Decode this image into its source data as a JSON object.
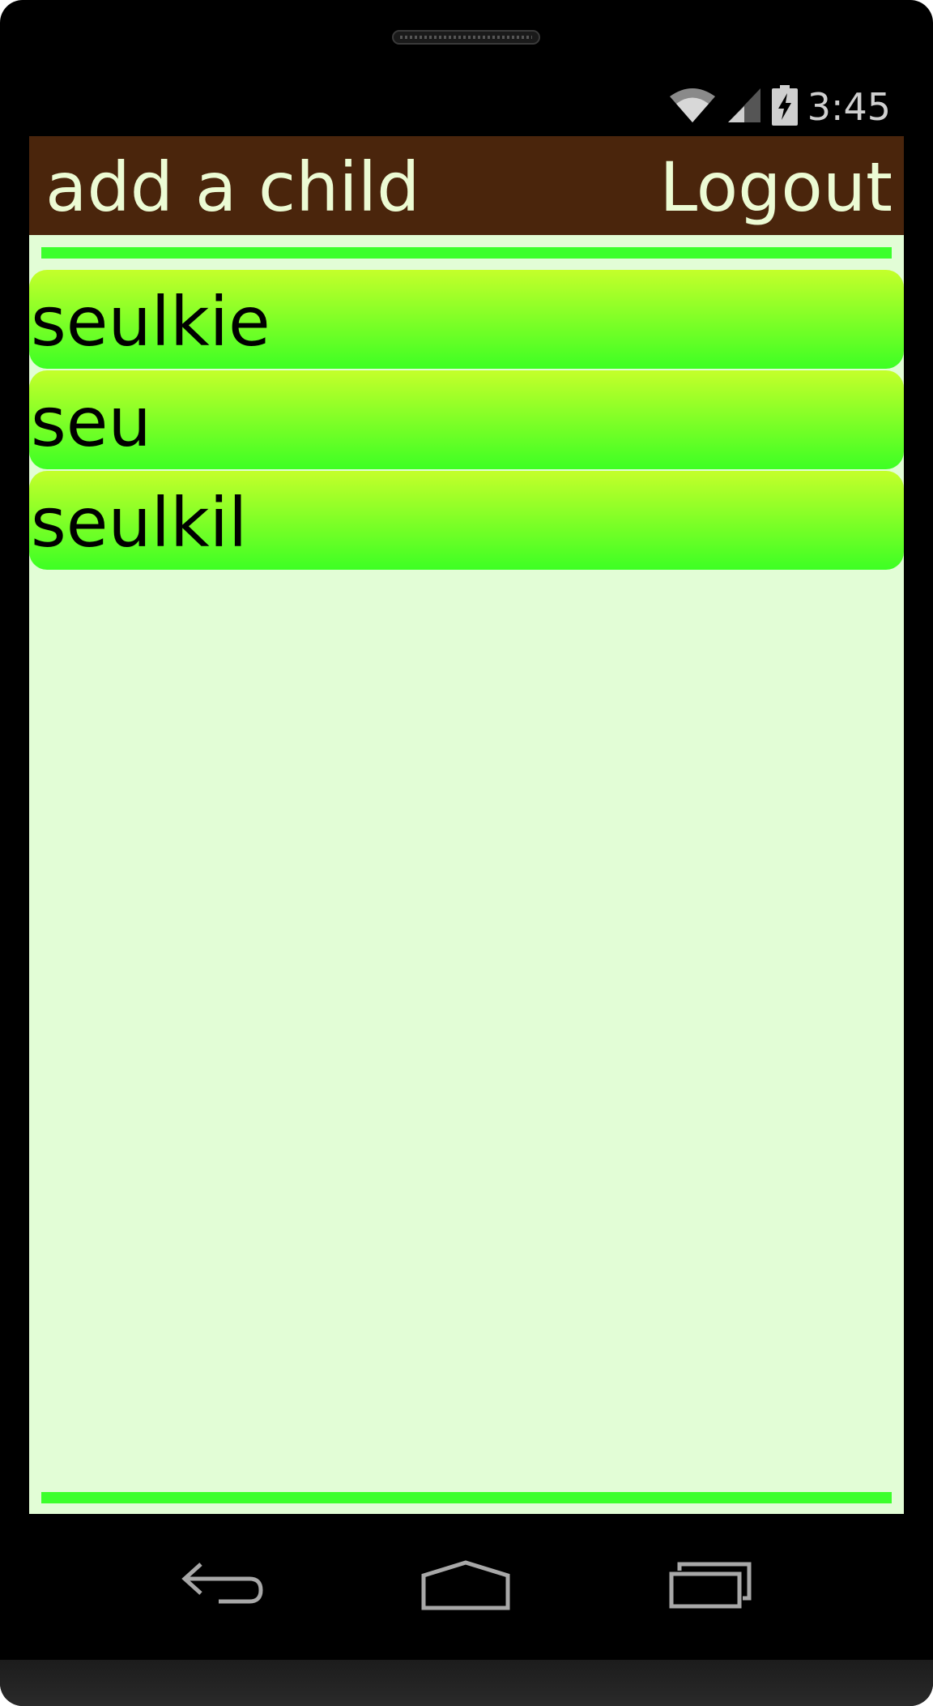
{
  "status_bar": {
    "time": "3:45",
    "icons": [
      "wifi-icon",
      "cell-signal-icon",
      "battery-charging-icon"
    ]
  },
  "app_bar": {
    "title": "add a child",
    "logout_label": "Logout",
    "background": "#4a250c",
    "text_color": "#ecfbd4"
  },
  "children": [
    {
      "name": "seulkie"
    },
    {
      "name": "seu"
    },
    {
      "name": "seulkil"
    }
  ],
  "theme": {
    "screen_background": "#e2fdd6",
    "divider_color": "#3cff2c",
    "item_gradient_top": "#c4ff2a",
    "item_gradient_bottom": "#3dff24"
  },
  "nav_bar": {
    "buttons": [
      "back-icon",
      "home-icon",
      "recent-apps-icon"
    ]
  }
}
